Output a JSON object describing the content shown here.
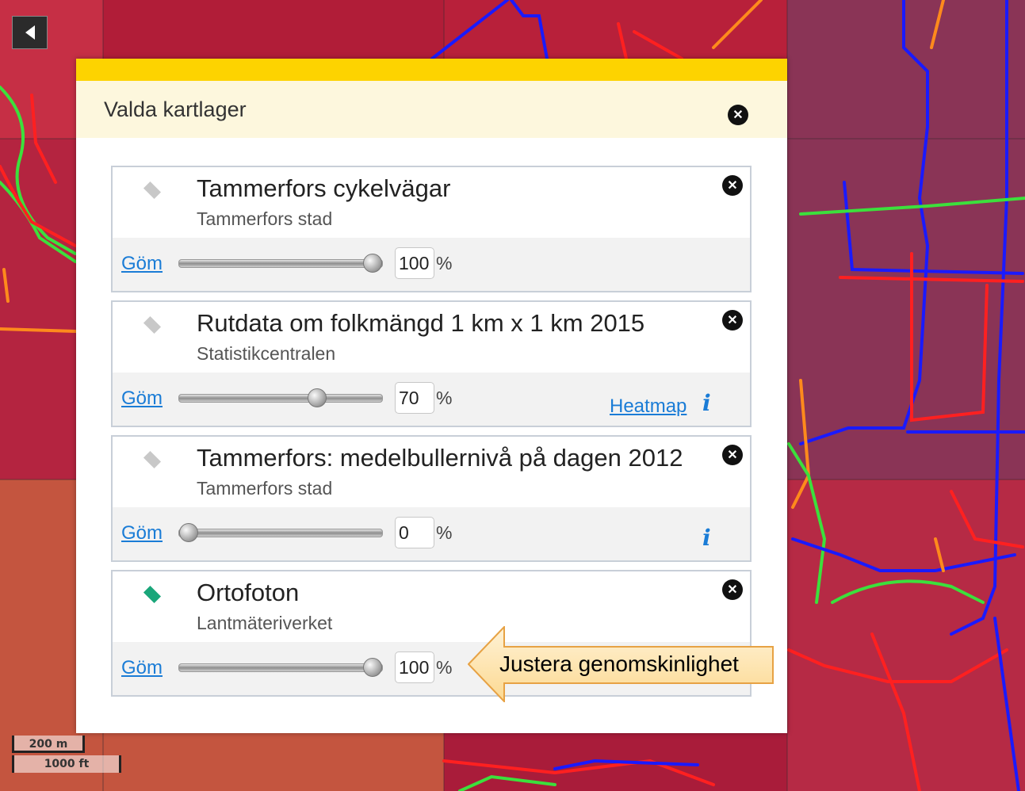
{
  "panel": {
    "title": "Valda kartlager",
    "accent_color": "#fdd300",
    "header_bg": "#fdf7dd"
  },
  "layers": [
    {
      "name": "Tammerfors cykelvägar",
      "source": "Tammerfors stad",
      "hide_label": "Göm",
      "opacity": "100",
      "opacity_value": 100,
      "percent": "%",
      "visible": false,
      "style_link": "",
      "has_info": false
    },
    {
      "name": "Rutdata om folkmängd 1 km x 1 km 2015",
      "source": "Statistikcentralen",
      "hide_label": "Göm",
      "opacity": "70",
      "opacity_value": 70,
      "percent": "%",
      "visible": false,
      "style_link": "Heatmap",
      "has_info": true
    },
    {
      "name": "Tammerfors: medelbullernivå på dagen 2012",
      "source": "Tammerfors stad",
      "hide_label": "Göm",
      "opacity": "0",
      "opacity_value": 0,
      "percent": "%",
      "visible": false,
      "style_link": "",
      "has_info": true
    },
    {
      "name": "Ortofoton",
      "source": "Lantmäteriverket",
      "hide_label": "Göm",
      "opacity": "100",
      "opacity_value": 100,
      "percent": "%",
      "visible": true,
      "style_link": "",
      "has_info": false
    }
  ],
  "callout": {
    "text": "Justera genomskinlighet",
    "color": "#fde8bf"
  },
  "scale": {
    "metric": "200 m",
    "imperial": "1000 ft"
  },
  "icons": {
    "close": "close-circle-icon",
    "info": "info-icon",
    "back": "back-arrow-icon",
    "layer_visible": "diamond-icon"
  },
  "colors": {
    "link": "#1a7cd6",
    "visible_layer": "#1aa67a",
    "hidden_layer": "#c8c8c8"
  }
}
